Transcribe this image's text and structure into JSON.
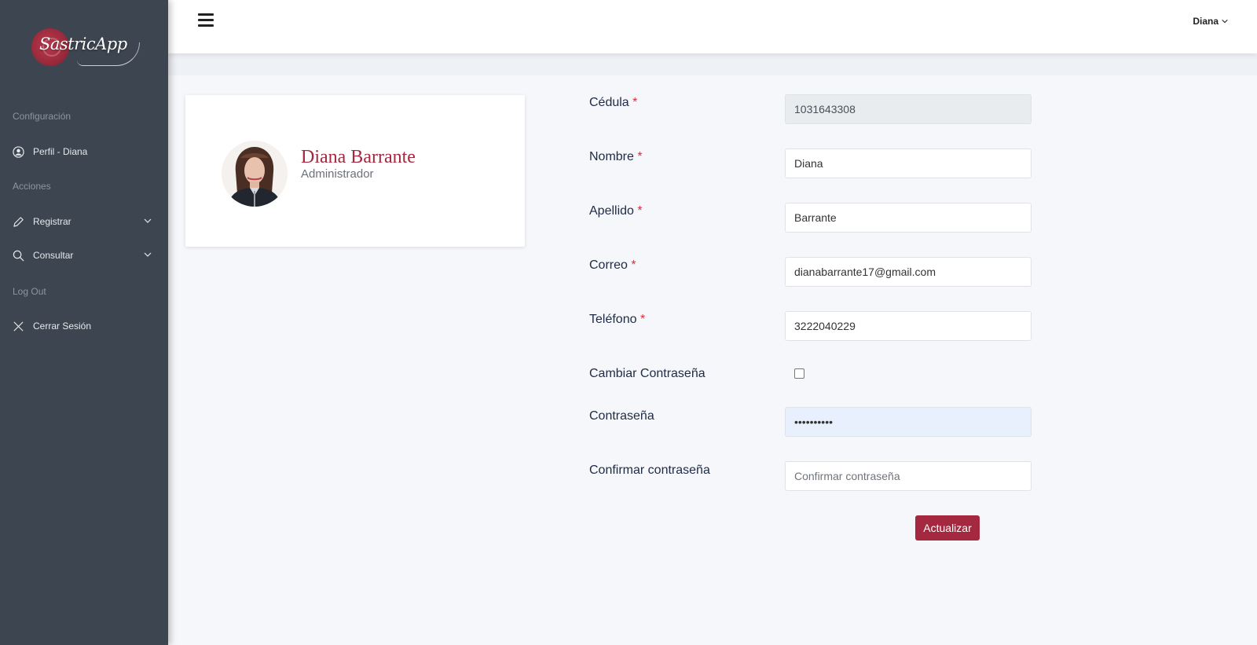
{
  "sidebar": {
    "logo_text": "SastricApp",
    "sections": {
      "config": "Configuración",
      "actions": "Acciones",
      "logout": "Log Out"
    },
    "items": [
      {
        "label": "Perfil - Diana",
        "icon": "user-circle-icon"
      },
      {
        "label": "Registrar",
        "icon": "pencil-icon"
      },
      {
        "label": "Consultar",
        "icon": "search-icon"
      },
      {
        "label": "Cerrar Sesión",
        "icon": "close-icon"
      }
    ]
  },
  "header": {
    "user": "Diana"
  },
  "profile": {
    "name": "Diana Barrante",
    "role": "Administrador"
  },
  "form": {
    "cedula": {
      "label": "Cédula",
      "value": "1031643308"
    },
    "nombre": {
      "label": "Nombre",
      "value": "Diana"
    },
    "apellido": {
      "label": "Apellido",
      "value": "Barrante"
    },
    "correo": {
      "label": "Correo",
      "value": "dianabarrante17@gmail.com"
    },
    "telefono": {
      "label": "Teléfono",
      "value": "3222040229"
    },
    "cambiar": {
      "label": "Cambiar Contraseña",
      "checked": false
    },
    "password": {
      "label": "Contraseña",
      "value": "••••••••••"
    },
    "confirm": {
      "label": "Confirmar contraseña",
      "placeholder": "Confirmar contraseña"
    },
    "required_mark": "*",
    "submit": "Actualizar"
  },
  "colors": {
    "sidebar_bg": "#3c4550",
    "accent": "#a4283f",
    "page_bg": "#f5f7fb"
  }
}
